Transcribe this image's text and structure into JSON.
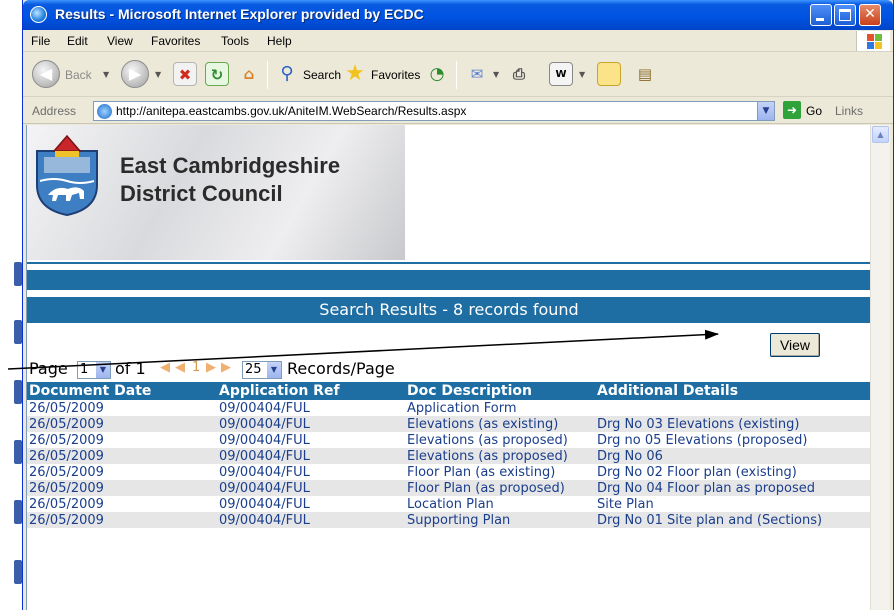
{
  "window": {
    "title": "Results - Microsoft Internet Explorer provided by ECDC",
    "min_glyph": "",
    "max_glyph": "",
    "close_glyph": "✕"
  },
  "menu": [
    "File",
    "Edit",
    "View",
    "Favorites",
    "Tools",
    "Help"
  ],
  "toolbar": {
    "back_label": "Back",
    "search_label": "Search",
    "favorites_label": "Favorites",
    "icons": [
      "back-icon",
      "forward-icon",
      "stop-icon",
      "refresh-icon",
      "home-icon",
      "search-icon",
      "favorites-star-icon",
      "history-icon",
      "mail-icon",
      "print-icon",
      "word-icon",
      "notes-icon",
      "research-icon"
    ]
  },
  "address": {
    "label": "Address",
    "url": "http://anitepa.eastcambs.gov.uk/AniteIM.WebSearch/Results.aspx",
    "go_label": "Go",
    "links_label": "Links"
  },
  "banner": {
    "line1": "East Cambridgeshire",
    "line2": "District Council"
  },
  "results": {
    "header": "Search Results - 8 records found",
    "view_button": "View"
  },
  "pager": {
    "page_label": "Page",
    "page_value": "1",
    "of_label": "of 1",
    "current_page": "1",
    "per_page_value": "25",
    "records_label": "Records/Page"
  },
  "table": {
    "columns": [
      "Document Date",
      "Application Ref",
      "Doc Description",
      "Additional Details"
    ],
    "rows": [
      [
        "26/05/2009",
        "09/00404/FUL",
        "Application Form",
        ""
      ],
      [
        "26/05/2009",
        "09/00404/FUL",
        "Elevations (as existing)",
        "Drg No 03 Elevations (existing)"
      ],
      [
        "26/05/2009",
        "09/00404/FUL",
        "Elevations (as proposed)",
        "Drg no 05 Elevations (proposed)"
      ],
      [
        "26/05/2009",
        "09/00404/FUL",
        "Elevations (as proposed)",
        "Drg No 06"
      ],
      [
        "26/05/2009",
        "09/00404/FUL",
        "Floor Plan (as existing)",
        "Drg No 02 Floor plan (existing)"
      ],
      [
        "26/05/2009",
        "09/00404/FUL",
        "Floor Plan (as proposed)",
        "Drg No 04 Floor plan as proposed"
      ],
      [
        "26/05/2009",
        "09/00404/FUL",
        "Location Plan",
        "Site Plan"
      ],
      [
        "26/05/2009",
        "09/00404/FUL",
        "Supporting Plan",
        "Drg No 01 Site plan and (Sections)"
      ]
    ]
  },
  "colors": {
    "accent": "#1f6ea3",
    "titlebar": "#0054e3",
    "row_alt": "#e6e6e6",
    "link_text": "#1a3e8c"
  }
}
